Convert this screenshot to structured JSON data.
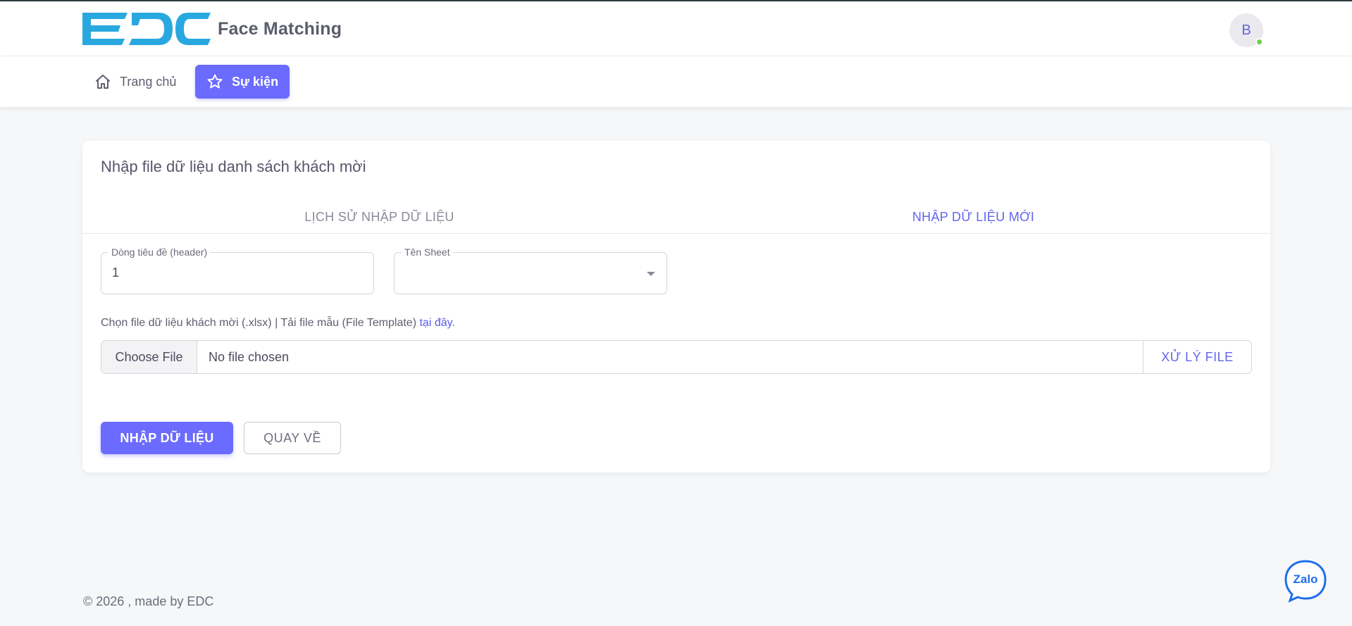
{
  "header": {
    "logo_text": "EDC",
    "app_name": "Face Matching",
    "avatar_initial": "B"
  },
  "nav": {
    "items": [
      {
        "label": "Trang chủ",
        "icon": "home-icon",
        "active": false
      },
      {
        "label": "Sự kiện",
        "icon": "star-icon",
        "active": true
      }
    ]
  },
  "card": {
    "title": "Nhập file dữ liệu danh sách khách mời",
    "tabs": [
      {
        "label": "LỊCH SỬ NHẬP DỮ LIỆU",
        "active": false
      },
      {
        "label": "NHẬP DỮ LIỆU MỚI",
        "active": true
      }
    ],
    "fields": {
      "header_label": "Dòng tiêu đề (header)",
      "header_value": "1",
      "sheet_label": "Tên Sheet",
      "sheet_value": ""
    },
    "file_hint": "Chọn file dữ liệu khách mời (.xlsx) | Tải file mẫu (File Template)",
    "file_hint_link": "tại đây",
    "file_hint_end": ".",
    "choose_file_label": "Choose File",
    "no_file_text": "No file chosen",
    "process_label": "XỬ LÝ FILE",
    "import_label": "NHẬP DỮ LIỆU",
    "back_label": "QUAY VỀ"
  },
  "footer": {
    "text": "© 2026 , made by EDC"
  },
  "zalo": {
    "label": "Zalo"
  },
  "colors": {
    "accent": "#6b6bff",
    "link": "#5a5ae8",
    "logo": "#29a8e0",
    "status_online": "#6ad04a"
  }
}
